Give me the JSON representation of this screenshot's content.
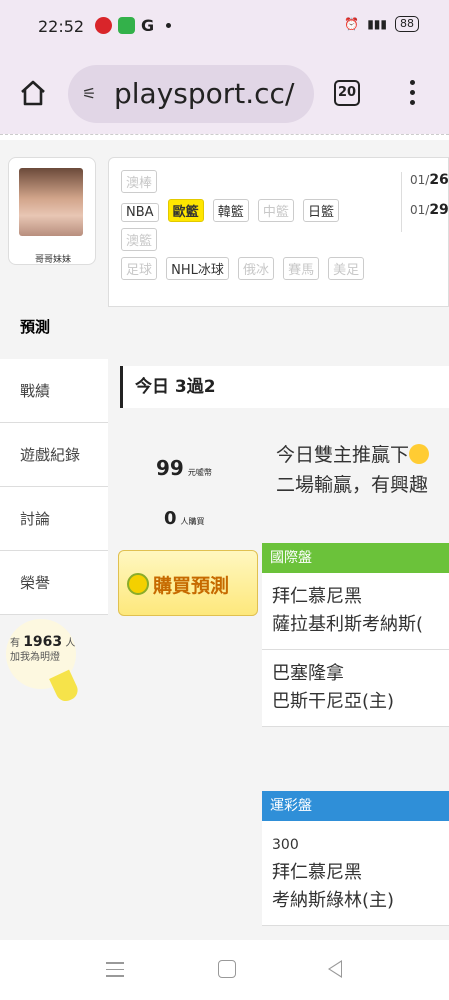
{
  "status": {
    "time": "22:52",
    "g": "G",
    "battery": "88"
  },
  "browser": {
    "url": "playsport.cc/",
    "tab_count": "20"
  },
  "profile": {
    "name": "哥哥妹妹"
  },
  "leagues": {
    "row1": [
      "澳棒"
    ],
    "row2": [
      "NBA",
      "歐籃",
      "韓籃",
      "中籃",
      "日籃"
    ],
    "row3": [
      "澳籃"
    ],
    "row4": [
      "足球",
      "NHL冰球",
      "俄冰",
      "賽馬",
      "美足"
    ]
  },
  "dates": [
    {
      "month": "01/",
      "day": "26"
    },
    {
      "month": "01/",
      "day": "29"
    }
  ],
  "sidebar": {
    "items": [
      {
        "label": "預測"
      },
      {
        "label": "戰績"
      },
      {
        "label": "遊戲紀錄"
      },
      {
        "label": "討論"
      },
      {
        "label": "榮譽"
      }
    ],
    "light": {
      "prefix": "有",
      "count": "1963",
      "suffix": "人",
      "caption": "加我為明燈"
    }
  },
  "today": {
    "label": "今日 3過2"
  },
  "stats": {
    "coins": "99",
    "coins_unit": "元噓幣",
    "buyers": "0",
    "buyers_unit": "人購買"
  },
  "post": {
    "line1": "今日雙主推贏下",
    "line2": "二場輸贏，有興趣"
  },
  "buy_button": {
    "label": "購買預測"
  },
  "cards": [
    {
      "header": "國際盤",
      "games": [
        {
          "home": "拜仁慕尼黑",
          "away": "薩拉基利斯考納斯("
        },
        {
          "home": "巴塞隆拿",
          "away": "巴斯干尼亞(主)"
        }
      ]
    },
    {
      "header": "運彩盤",
      "games": [
        {
          "num": "300",
          "home": "拜仁慕尼黑",
          "away": "考納斯綠林(主)"
        }
      ]
    }
  ],
  "colors": {
    "green": "#6bc23a",
    "blue": "#2f8fd8",
    "highlight": "#ffe600"
  }
}
